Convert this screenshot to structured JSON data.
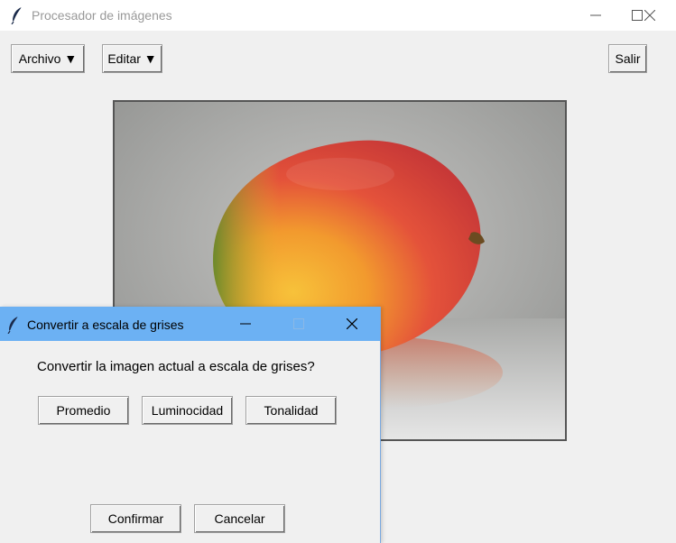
{
  "window": {
    "title": "Procesador de imágenes",
    "controls": [
      "minimize-icon",
      "maximize-icon",
      "close-icon"
    ]
  },
  "toolbar": {
    "archivo_label": "Archivo ▼",
    "editar_label": "Editar ▼",
    "salir_label": "Salir"
  },
  "canvas": {
    "image_subject": "mango"
  },
  "dialog": {
    "title": "Convertir a escala de grises",
    "prompt": "Convertir la imagen actual a escala de grises?",
    "options": {
      "promedio": "Promedio",
      "luminocidad": "Luminocidad",
      "tonalidad": "Tonalidad"
    },
    "confirm_label": "Confirmar",
    "cancel_label": "Cancelar",
    "titlebar_color": "#6cb1f3"
  }
}
